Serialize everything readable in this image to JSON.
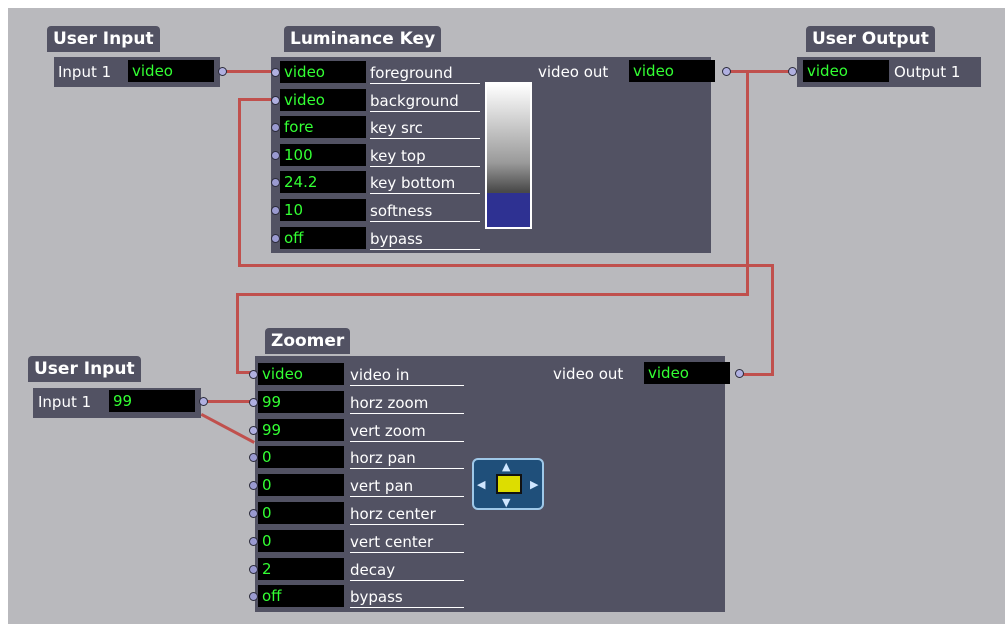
{
  "colors": {
    "canvas_bg": "#b9b9bd",
    "panel_bg": "#525263",
    "value_text": "#33ff33",
    "wire": "#c0504d",
    "port": "#9a9ad0"
  },
  "user_input_1": {
    "title": "User Input",
    "label": "Input 1",
    "value": "video"
  },
  "luminance_key": {
    "title": "Luminance Key",
    "output_label": "video out",
    "output_value": "video",
    "inputs": [
      {
        "value": "video",
        "label": "foreground"
      },
      {
        "value": "video",
        "label": "background"
      },
      {
        "value": "fore",
        "label": "key src"
      },
      {
        "value": "100",
        "label": "key top"
      },
      {
        "value": "24.2",
        "label": "key bottom"
      },
      {
        "value": "10",
        "label": "softness"
      },
      {
        "value": "off",
        "label": "bypass"
      }
    ],
    "key_level_fraction": 0.24,
    "swatch_fill_color": "#2e3192"
  },
  "user_output": {
    "title": "User Output",
    "value": "video",
    "label": "Output 1"
  },
  "user_input_2": {
    "title": "User Input",
    "label": "Input 1",
    "value": "99"
  },
  "zoomer": {
    "title": "Zoomer",
    "output_label": "video out",
    "output_value": "video",
    "inputs": [
      {
        "value": "video",
        "label": "video in"
      },
      {
        "value": "99",
        "label": "horz zoom"
      },
      {
        "value": "99",
        "label": "vert zoom"
      },
      {
        "value": "0",
        "label": "horz pan"
      },
      {
        "value": "0",
        "label": "vert pan"
      },
      {
        "value": "0",
        "label": "horz center"
      },
      {
        "value": "0",
        "label": "vert center"
      },
      {
        "value": "2",
        "label": "decay"
      },
      {
        "value": "off",
        "label": "bypass"
      }
    ],
    "control_icon": "zoom-pan-control-icon"
  }
}
